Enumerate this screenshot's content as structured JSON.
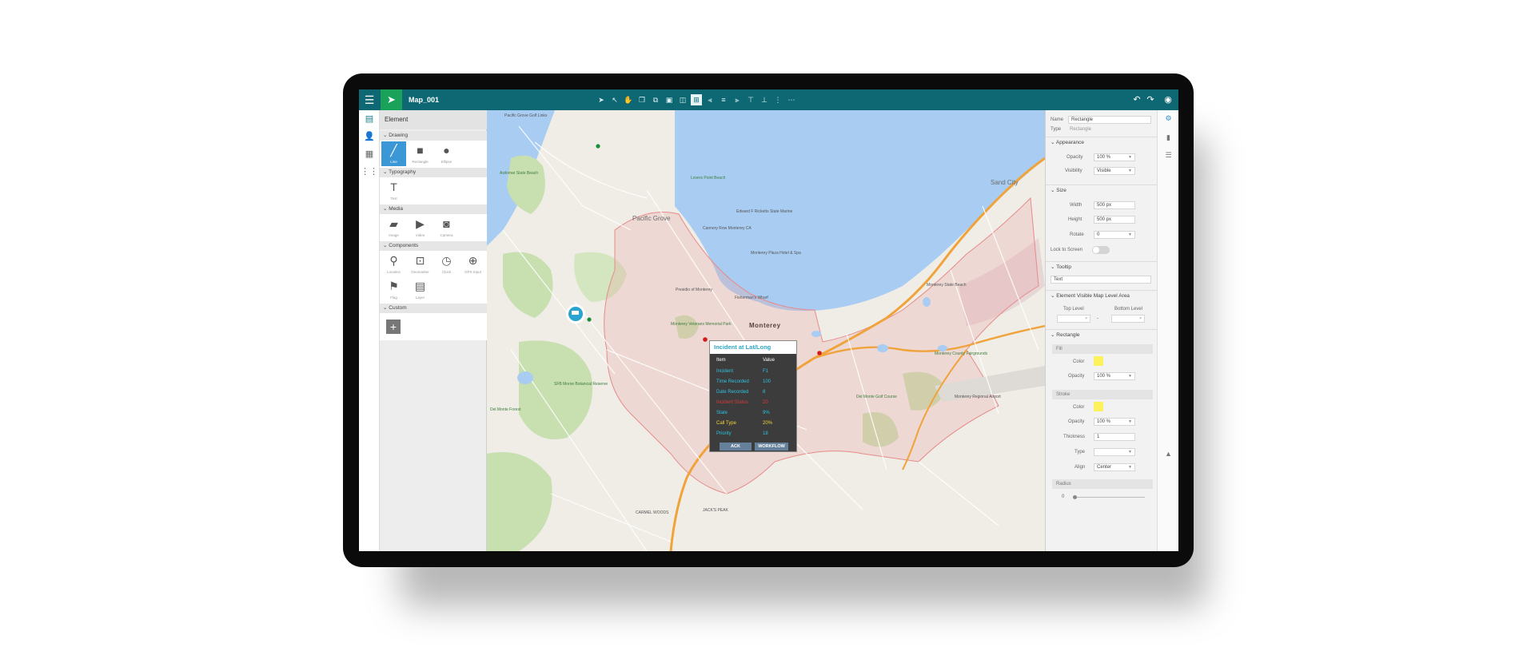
{
  "app": {
    "title": "Map_001"
  },
  "left_panel": {
    "title": "Element",
    "sections": {
      "drawing": {
        "label": "Drawing",
        "items": [
          "Line",
          "Rectangle",
          "Ellipse"
        ]
      },
      "typography": {
        "label": "Typography",
        "items": [
          "Text"
        ]
      },
      "media": {
        "label": "Media",
        "items": [
          "Image",
          "Video",
          "Camera"
        ]
      },
      "components": {
        "label": "Components",
        "items": [
          "Location",
          "Geomarker",
          "Clock",
          "GPS Input",
          "Flag",
          "Layer"
        ]
      },
      "custom": {
        "label": "Custom"
      }
    }
  },
  "map": {
    "labels": {
      "pacific_grove_golf": "Pacific Grove Golf Links",
      "asilomar": "Asilomar State Beach",
      "lovers_point": "Lovers Point Beach",
      "pacific_grove": "Pacific Grove",
      "cannery_row": "Cannery Row Monterey CA",
      "edward_ricketts": "Edward F Ricketts State Marine",
      "monterey_plaza": "Monterey Plaza Hotel & Spa",
      "presidio": "Presidio of Monterey",
      "fishermans_wharf": "Fisherman's Wharf",
      "monterey": "Monterey",
      "veterans_park": "Monterey Veterans Memorial Park",
      "state_beach": "Monterey State Beach",
      "sand_city": "Sand City",
      "fairgrounds": "Monterey County Fairgrounds",
      "airport": "Monterey Regional Airport",
      "del_monte_golf": "Del Monte Golf Course",
      "botanical": "SFB Morse Botanical Reserve",
      "del_monte_forest": "Del Monte Forest",
      "carmel_woods": "CARMEL WOODS",
      "jacks_peak": "JACK'S PEAK"
    }
  },
  "popup": {
    "title": "Incident at Lat/Long",
    "header_item": "Item",
    "header_value": "Value",
    "rows": [
      {
        "key": "Incident",
        "value": "F1",
        "color": "#2ec3e0"
      },
      {
        "key": "Time Recorded",
        "value": "100",
        "color": "#2ec3e0"
      },
      {
        "key": "Date Recorded",
        "value": "8",
        "color": "#2ec3e0"
      },
      {
        "key": "Incident Status",
        "value": "20",
        "color": "#d93b3b"
      },
      {
        "key": "State",
        "value": "9%",
        "color": "#2ec3e0"
      },
      {
        "key": "Call Type",
        "value": "20%",
        "color": "#f4d33b"
      },
      {
        "key": "Priority",
        "value": "18",
        "color": "#2ec3e0"
      }
    ],
    "ack": "ACK",
    "workflow": "WORKFLOW"
  },
  "props": {
    "name_label": "Name",
    "name_value": "Rectangle",
    "type_label": "Type",
    "type_value": "Rectangle",
    "appearance": {
      "label": "Appearance",
      "opacity_label": "Opacity",
      "opacity_value": "100 %",
      "visibility_label": "Visibility",
      "visibility_value": "Visible"
    },
    "size": {
      "label": "Size",
      "width_label": "Width",
      "width_value": "500 px",
      "height_label": "Height",
      "height_value": "500 px",
      "rotate_label": "Rotate",
      "rotate_value": "0",
      "lock_label": "Lock to Screen"
    },
    "tooltip": {
      "label": "Tooltip",
      "value": "Text"
    },
    "visible_map_level": {
      "label": "Element Visible Map Level Area",
      "top_label": "Top Level",
      "bottom_label": "Bottom Level",
      "dash": "-"
    },
    "rectangle": {
      "label": "Rectangle",
      "fill_label": "Fill",
      "color_label": "Color",
      "opacity_label": "Opacity",
      "fill_opacity": "100 %",
      "stroke_label": "Stroke",
      "stroke_opacity": "100 %",
      "thickness_label": "Thickness",
      "thickness_value": "1",
      "type_label": "Type",
      "align_label": "Align",
      "align_value": "Center",
      "radius_label": "Radius",
      "radius_value": "0",
      "fill_color": "#fbf25d"
    }
  },
  "colors": {
    "topbar": "#0e6873",
    "brand": "#1aa25a",
    "selected": "#3c97d6",
    "water": "#a9cdf2",
    "boundary": "#e88a8a"
  }
}
